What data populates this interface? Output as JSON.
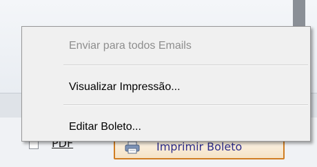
{
  "context_menu": {
    "items": [
      {
        "label": "Enviar para todos Emails",
        "enabled": false
      },
      {
        "label": "Visualizar Impressão...",
        "enabled": true
      },
      {
        "label": "Editar Boleto...",
        "enabled": true
      }
    ]
  },
  "background": {
    "pdf_checkbox_label": "PDF",
    "pdf_checked": false,
    "print_button_label": "Imprimir Boleto",
    "print_icon": "printer-icon"
  },
  "colors": {
    "menu_bg": "#f0f0f0",
    "disabled_text": "#8d8d8d",
    "button_border": "#d07d22"
  }
}
